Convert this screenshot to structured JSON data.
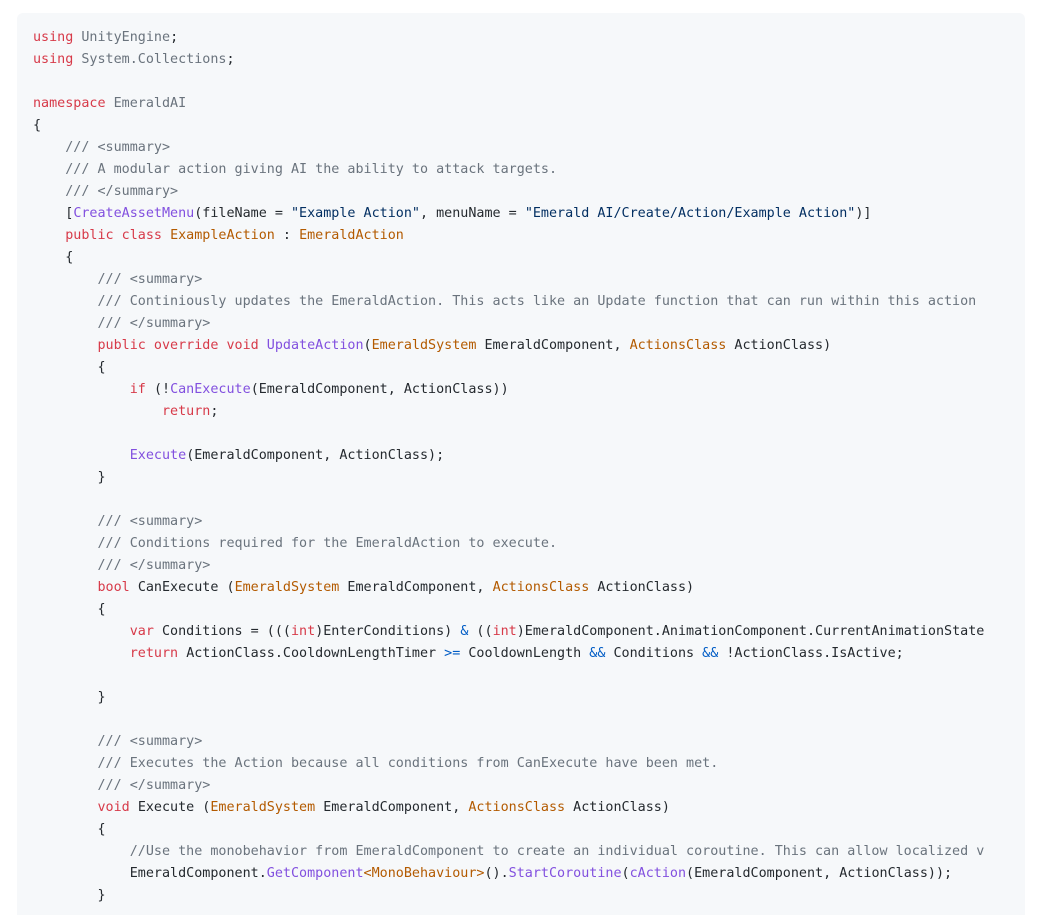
{
  "code": {
    "language": "csharp",
    "lines": [
      [
        [
          "kw",
          "using"
        ],
        [
          "ns",
          " UnityEngine"
        ],
        [
          "pl",
          ";"
        ]
      ],
      [
        [
          "kw",
          "using"
        ],
        [
          "ns",
          " System.Collections"
        ],
        [
          "pl",
          ";"
        ]
      ],
      [],
      [
        [
          "kw",
          "namespace"
        ],
        [
          "ns",
          " EmeraldAI"
        ]
      ],
      [
        [
          "pl",
          "{"
        ]
      ],
      [
        [
          "cm",
          "    /// <summary>"
        ]
      ],
      [
        [
          "cm",
          "    /// A modular action giving AI the ability to attack targets."
        ]
      ],
      [
        [
          "cm",
          "    /// </summary>"
        ]
      ],
      [
        [
          "pl",
          "    ["
        ],
        [
          "fn",
          "CreateAssetMenu"
        ],
        [
          "pl",
          "(fileName = "
        ],
        [
          "str",
          "\"Example Action\""
        ],
        [
          "pl",
          ", menuName = "
        ],
        [
          "str",
          "\"Emerald AI/Create/Action/Example Action\""
        ],
        [
          "pl",
          ")]"
        ]
      ],
      [
        [
          "kw",
          "    public class "
        ],
        [
          "ty",
          "ExampleAction"
        ],
        [
          "pl",
          " : "
        ],
        [
          "ty",
          "EmeraldAction"
        ]
      ],
      [
        [
          "pl",
          "    {"
        ]
      ],
      [
        [
          "cm",
          "        /// <summary>"
        ]
      ],
      [
        [
          "cm",
          "        /// Continiously updates the EmeraldAction. This acts like an Update function that can run within this action"
        ]
      ],
      [
        [
          "cm",
          "        /// </summary>"
        ]
      ],
      [
        [
          "kw",
          "        public override void "
        ],
        [
          "fn",
          "UpdateAction"
        ],
        [
          "pl",
          "("
        ],
        [
          "ty",
          "EmeraldSystem"
        ],
        [
          "pl",
          " EmeraldComponent, "
        ],
        [
          "ty",
          "ActionsClass"
        ],
        [
          "pl",
          " ActionClass)"
        ]
      ],
      [
        [
          "pl",
          "        {"
        ]
      ],
      [
        [
          "kw",
          "            if "
        ],
        [
          "pl",
          "(!"
        ],
        [
          "fn",
          "CanExecute"
        ],
        [
          "pl",
          "(EmeraldComponent, ActionClass))"
        ]
      ],
      [
        [
          "kw",
          "                return"
        ],
        [
          "pl",
          ";"
        ]
      ],
      [],
      [
        [
          "fn",
          "            Execute"
        ],
        [
          "pl",
          "(EmeraldComponent, ActionClass);"
        ]
      ],
      [
        [
          "pl",
          "        }"
        ]
      ],
      [],
      [
        [
          "cm",
          "        /// <summary>"
        ]
      ],
      [
        [
          "cm",
          "        /// Conditions required for the EmeraldAction to execute."
        ]
      ],
      [
        [
          "cm",
          "        /// </summary>"
        ]
      ],
      [
        [
          "kw",
          "        bool "
        ],
        [
          "pl",
          "CanExecute ("
        ],
        [
          "ty",
          "EmeraldSystem"
        ],
        [
          "pl",
          " EmeraldComponent, "
        ],
        [
          "ty",
          "ActionsClass"
        ],
        [
          "pl",
          " ActionClass)"
        ]
      ],
      [
        [
          "pl",
          "        {"
        ]
      ],
      [
        [
          "kw",
          "            var "
        ],
        [
          "pl",
          "Conditions = ((("
        ],
        [
          "kw",
          "int"
        ],
        [
          "pl",
          ")EnterConditions) "
        ],
        [
          "op",
          "&"
        ],
        [
          "pl",
          " (("
        ],
        [
          "kw",
          "int"
        ],
        [
          "pl",
          ")EmeraldComponent.AnimationComponent.CurrentAnimationState"
        ]
      ],
      [
        [
          "kw",
          "            return "
        ],
        [
          "pl",
          "ActionClass.CooldownLengthTimer "
        ],
        [
          "op",
          ">="
        ],
        [
          "pl",
          " CooldownLength "
        ],
        [
          "op",
          "&&"
        ],
        [
          "pl",
          " Conditions "
        ],
        [
          "op",
          "&&"
        ],
        [
          "pl",
          " !ActionClass.IsActive;"
        ]
      ],
      [],
      [
        [
          "pl",
          "        }"
        ]
      ],
      [],
      [
        [
          "cm",
          "        /// <summary>"
        ]
      ],
      [
        [
          "cm",
          "        /// Executes the Action because all conditions from CanExecute have been met."
        ]
      ],
      [
        [
          "cm",
          "        /// </summary>"
        ]
      ],
      [
        [
          "kw",
          "        void "
        ],
        [
          "pl",
          "Execute ("
        ],
        [
          "ty",
          "EmeraldSystem"
        ],
        [
          "pl",
          " EmeraldComponent, "
        ],
        [
          "ty",
          "ActionsClass"
        ],
        [
          "pl",
          " ActionClass)"
        ]
      ],
      [
        [
          "pl",
          "        {"
        ]
      ],
      [
        [
          "cm",
          "            //Use the monobehavior from EmeraldComponent to create an individual coroutine. This can allow localized v"
        ]
      ],
      [
        [
          "pl",
          "            EmeraldComponent."
        ],
        [
          "fn",
          "GetComponent"
        ],
        [
          "ty",
          "<MonoBehaviour>"
        ],
        [
          "pl",
          "()."
        ],
        [
          "fn",
          "StartCoroutine"
        ],
        [
          "pl",
          "("
        ],
        [
          "fn",
          "cAction"
        ],
        [
          "pl",
          "(EmeraldComponent, ActionClass));"
        ]
      ],
      [
        [
          "pl",
          "        }"
        ]
      ]
    ]
  },
  "colors": {
    "background": "#f6f8fa",
    "keyword": "#d73a49",
    "type": "#b35a00",
    "function": "#8250df",
    "string": "#032f62",
    "comment": "#6a737d",
    "operator": "#005cc5",
    "plain": "#24292e"
  }
}
